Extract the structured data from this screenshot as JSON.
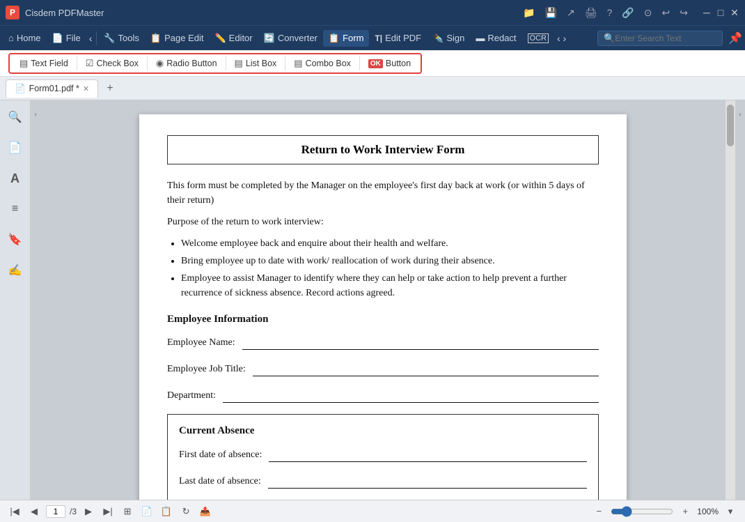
{
  "app": {
    "title": "Cisdem PDFMaster",
    "logo": "P"
  },
  "titlebar": {
    "icons": [
      "file-folder",
      "save",
      "share",
      "print",
      "help",
      "bookmark",
      "undo",
      "redo"
    ],
    "controls": [
      "minimize",
      "maximize",
      "close"
    ]
  },
  "menubar": {
    "items": [
      {
        "id": "home",
        "label": "Home",
        "icon": "⌂"
      },
      {
        "id": "file",
        "label": "File",
        "icon": "📄"
      },
      {
        "id": "nav-back",
        "label": "‹",
        "type": "arrow"
      },
      {
        "id": "tools",
        "label": "Tools",
        "icon": "🔧"
      },
      {
        "id": "page-edit",
        "label": "Page Edit",
        "icon": "📋"
      },
      {
        "id": "editor",
        "label": "Editor",
        "icon": "✏️"
      },
      {
        "id": "converter",
        "label": "Converter",
        "icon": "🔄"
      },
      {
        "id": "form",
        "label": "Form",
        "icon": "📋",
        "active": true
      },
      {
        "id": "edit-pdf",
        "label": "Edit PDF",
        "icon": "T"
      },
      {
        "id": "sign",
        "label": "Sign",
        "icon": "✒️"
      },
      {
        "id": "redact",
        "label": "Redact",
        "icon": "▬"
      },
      {
        "id": "ocr",
        "label": "OCR",
        "icon": "OCR"
      },
      {
        "id": "nav-more",
        "label": "›",
        "type": "arrow"
      }
    ],
    "search": {
      "placeholder": "Enter Search Text"
    }
  },
  "toolbar": {
    "items": [
      {
        "id": "text-field",
        "label": "Text Field",
        "icon": "▤"
      },
      {
        "id": "check-box",
        "label": "Check Box",
        "icon": "☑"
      },
      {
        "id": "radio-button",
        "label": "Radio Button",
        "icon": "◉"
      },
      {
        "id": "list-box",
        "label": "List Box",
        "icon": "▤"
      },
      {
        "id": "combo-box",
        "label": "Combo Box",
        "icon": "▤"
      },
      {
        "id": "button",
        "label": "Button",
        "icon": "OK"
      }
    ]
  },
  "tabs": {
    "items": [
      {
        "id": "form01",
        "label": "Form01.pdf *",
        "active": true
      }
    ]
  },
  "sidebar": {
    "items": [
      {
        "id": "search",
        "icon": "🔍"
      },
      {
        "id": "pages",
        "icon": "📄"
      },
      {
        "id": "text",
        "icon": "A"
      },
      {
        "id": "annotations",
        "icon": "≡"
      },
      {
        "id": "bookmarks",
        "icon": "🔖"
      },
      {
        "id": "signatures",
        "icon": "✍"
      }
    ]
  },
  "pdf": {
    "title": "Return to Work Interview Form",
    "intro": "This form must be completed by the Manager on the employee's first day back at work (or within 5 days of their return)",
    "purpose_heading": "Purpose of the return to work interview:",
    "bullet_points": [
      "Welcome employee back and enquire about their health and welfare.",
      "Bring employee up to date with work/ reallocation of work during their absence.",
      "Employee to assist Manager to identify where they can help or take action to help prevent a further recurrence of sickness absence. Record actions agreed."
    ],
    "section_employee": "Employee Information",
    "fields": [
      {
        "label": "Employee Name:"
      },
      {
        "label": "Employee Job Title:"
      },
      {
        "label": "Department:"
      }
    ],
    "section_absence": "Current Absence",
    "absence_fields": [
      {
        "label": "First date of absence:"
      },
      {
        "label": "Last date of absence:"
      }
    ]
  },
  "bottombar": {
    "page_current": "1",
    "page_total": "/3",
    "zoom": "100%"
  }
}
